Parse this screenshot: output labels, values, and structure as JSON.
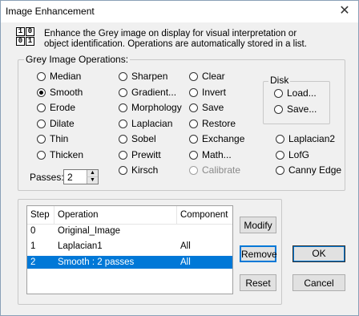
{
  "window": {
    "title": "Image Enhancement",
    "close_glyph": "✕"
  },
  "header": {
    "logo_digits": [
      "1",
      "0",
      "0",
      "1"
    ],
    "description": "Enhance the Grey image on display for visual interpretation or object identification. Operations are automatically stored in a list."
  },
  "operations_group": {
    "label": "Grey Image Operations:",
    "col1": [
      {
        "label": "Median",
        "checked": false
      },
      {
        "label": "Smooth",
        "checked": true
      },
      {
        "label": "Erode",
        "checked": false
      },
      {
        "label": "Dilate",
        "checked": false
      },
      {
        "label": "Thin",
        "checked": false
      },
      {
        "label": "Thicken",
        "checked": false
      }
    ],
    "col2": [
      {
        "label": "Sharpen"
      },
      {
        "label": "Gradient..."
      },
      {
        "label": "Morphology"
      },
      {
        "label": "Laplacian"
      },
      {
        "label": "Sobel"
      },
      {
        "label": "Prewitt"
      },
      {
        "label": "Kirsch"
      }
    ],
    "col3": [
      {
        "label": "Clear"
      },
      {
        "label": "Invert"
      },
      {
        "label": "Save"
      },
      {
        "label": "Restore"
      },
      {
        "label": "Exchange"
      },
      {
        "label": "Math..."
      },
      {
        "label": "Calibrate",
        "disabled": true
      }
    ],
    "col4": [
      {
        "label": "Laplacian2"
      },
      {
        "label": "LofG"
      },
      {
        "label": "Canny Edge"
      }
    ],
    "disk": {
      "label": "Disk",
      "load": "Load...",
      "save": "Save..."
    },
    "passes": {
      "label": "Passes:",
      "value": "2",
      "up": "▲",
      "down": "▼"
    }
  },
  "history": {
    "columns": [
      "Step",
      "Operation",
      "Component"
    ],
    "rows": [
      {
        "step": "0",
        "operation": "Original_Image",
        "component": "",
        "selected": false
      },
      {
        "step": "1",
        "operation": "Laplacian1",
        "component": "All",
        "selected": false
      },
      {
        "step": "2",
        "operation": "Smooth : 2 passes",
        "component": "All",
        "selected": true
      }
    ]
  },
  "buttons": {
    "modify": "Modify",
    "remove": "Remove",
    "reset": "Reset",
    "ok": "OK",
    "cancel": "Cancel"
  }
}
